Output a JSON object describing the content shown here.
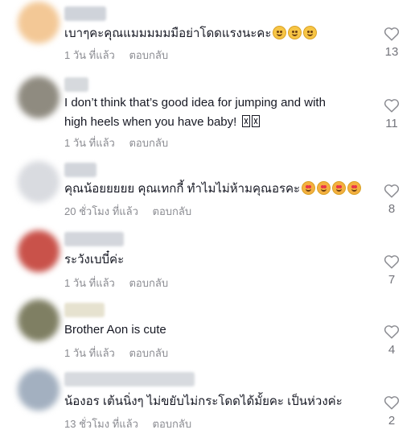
{
  "comments": [
    {
      "text": "เบาๆคะคุณแมมมมมมือย่าโดดแรงนะคะ",
      "emoji": [
        "grinning-sweat",
        "grinning-sweat",
        "grinning-sweat"
      ],
      "time": "1 วัน ที่แล้ว",
      "reply_label": "ตอบกลับ",
      "like_count": "13",
      "avatar_color": "#f3c896",
      "name_color": "#cfd3da"
    },
    {
      "text_line1": "I don’t think that’s good idea for jumping and with",
      "text_line2": "high heels when you have baby!",
      "time": "1 วัน ที่แล้ว",
      "reply_label": "ตอบกลับ",
      "like_count": "11",
      "avatar_color": "#8f8b80",
      "name_color": "#d6d9dd"
    },
    {
      "text": "คุณน้อยยยยย คุณเทกกี้ ทำไมไม่ห้ามคุณอรคะ",
      "emoji": [
        "smiling-hearts",
        "smiling-hearts",
        "smiling-hearts",
        "smiling-hearts"
      ],
      "time": "20 ชั่วโมง ที่แล้ว",
      "reply_label": "ตอบกลับ",
      "like_count": "8",
      "avatar_color": "#d9dbe0",
      "name_color": "#d2d5db"
    },
    {
      "text": "ระวังเบบี๋ค่ะ",
      "time": "1 วัน ที่แล้ว",
      "reply_label": "ตอบกลับ",
      "like_count": "7",
      "avatar_color": "#c9524a",
      "name_color": "#d3d6dc"
    },
    {
      "text": "Brother Aon is cute",
      "time": "1 วัน ที่แล้ว",
      "reply_label": "ตอบกลับ",
      "like_count": "4",
      "avatar_color": "#7f7f63",
      "name_color": "#e6e2cf"
    },
    {
      "text": "น้องอร เต้นนิ่งๆ ไม่ขยับไม่กระโดดได้มั้ยคะ เป็นห่วงค่ะ",
      "time": "13 ชั่วโมง ที่แล้ว",
      "reply_label": "ตอบกลับ",
      "like_count": "2",
      "avatar_color": "#a3b0c0",
      "name_color": "#d7dadf"
    }
  ]
}
